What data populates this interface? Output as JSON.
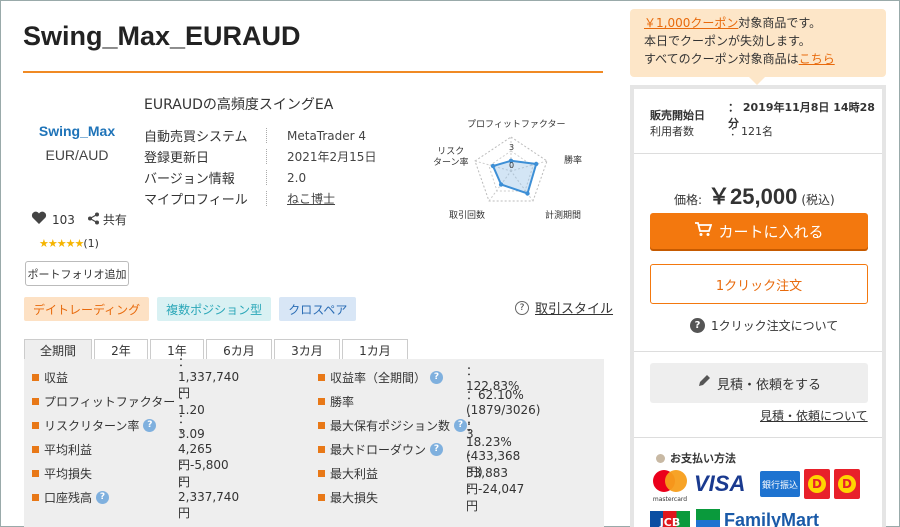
{
  "product": {
    "title": "Swing_Max_EURAUD",
    "subtitle": "EURAUDの高頻度スイングEA",
    "logo_line1": "Swing_Max",
    "logo_line2": "EUR/AUD"
  },
  "info": [
    {
      "key": "自動売買システム",
      "value": "MetaTrader 4"
    },
    {
      "key": "登録更新日",
      "value": "2021年2月15日"
    },
    {
      "key": "バージョン情報",
      "value": "2.0"
    },
    {
      "key": "マイプロフィール",
      "value": "ねこ博士"
    }
  ],
  "social": {
    "likes": "103",
    "share": "共有",
    "stars": "★★★★★",
    "reviews": "(1)",
    "portfolio_button": "ポートフォリオ追加"
  },
  "radar": {
    "labels": {
      "top": "プロフィットファクター",
      "right": "勝率",
      "bottom_right": "計測期間",
      "bottom_left": "取引回数",
      "left": "リスク\nターン率"
    },
    "left_l1": "リスク",
    "left_l2": "ターン率",
    "ticks": [
      "3",
      "0"
    ],
    "values": {
      "profit_factor": 0.3,
      "win_rate": 0.7,
      "period": 0.75,
      "trades": 0.45,
      "risk_return": 0.5
    }
  },
  "tags": [
    "デイトレーディング",
    "複数ポジション型",
    "クロスペア"
  ],
  "style_link": "取引スタイル",
  "tabs": [
    "全期間",
    "2年",
    "1年",
    "6カ月",
    "3カ月",
    "1カ月"
  ],
  "stats_left": [
    {
      "label": "収益",
      "value": "：1,337,740円",
      "help": false
    },
    {
      "label": "プロフィットファクター",
      "value": "：1.20",
      "help": false
    },
    {
      "label": "リスクリターン率",
      "value": "：3.09",
      "help": true
    },
    {
      "label": "平均利益",
      "value": "：4,265円",
      "help": false
    },
    {
      "label": "平均損失",
      "value": "：-5,800円",
      "help": false
    },
    {
      "label": "口座残高",
      "value": "：2,337,740円",
      "help": true
    }
  ],
  "stats_right": [
    {
      "label": "収益率（全期間）",
      "value": "：122.83%",
      "help": true
    },
    {
      "label": "勝率",
      "value": "：62.10% (1879/3026)",
      "help": false
    },
    {
      "label": "最大保有ポジション数",
      "value": "：3",
      "help": true
    },
    {
      "label": "最大ドローダウン",
      "value": "：18.23% (433,368円)",
      "help": true
    },
    {
      "label": "最大利益",
      "value": "：33,883円",
      "help": false
    },
    {
      "label": "最大損失",
      "value": "：-24,047円",
      "help": false
    }
  ],
  "coupon": {
    "amount": "￥1,000クーポン",
    "line1_rest": "対象商品です。",
    "line2": "本日でクーポンが失効します。",
    "line3_pre": "すべてのクーポン対象商品は",
    "line3_link": "こちら"
  },
  "sale": {
    "start_label": "販売開始日",
    "start_value": "：  2019年11月8日 14時28分",
    "users_label": "利用者数",
    "users_value": "：121名",
    "price_label": "価格:",
    "price": "￥25,000",
    "tax": "(税込)",
    "cart_button": "カートに入れる",
    "oneclick_button": "1クリック注文",
    "oneclick_about": "1クリック注文について",
    "estimate_button": "見積・依頼をする",
    "estimate_link": "見積・依頼について",
    "payment_title": "お支払い方法"
  },
  "payment_logos": {
    "mastercard": "mastercard",
    "visa": "VISA",
    "bank": "銀行振込",
    "jcb": "JCB",
    "familymart": "FamilyMart"
  },
  "colors": {
    "accent": "#f3780e",
    "link_blue": "#1e73b8",
    "coupon_bg": "#fde6c8"
  }
}
